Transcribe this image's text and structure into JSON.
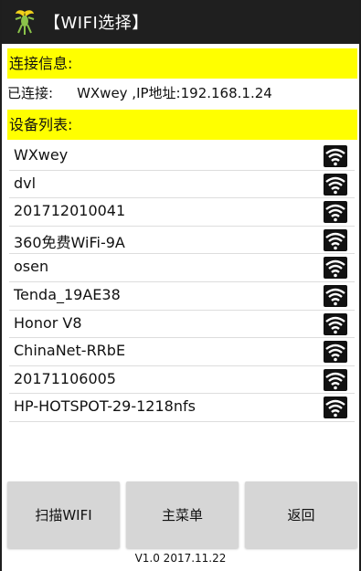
{
  "app": {
    "title": "【WIFI选择】"
  },
  "connection": {
    "section_label": "连接信息:",
    "status_label": "已连接:",
    "status_value": "WXwey ,IP地址:192.168.1.24"
  },
  "devices": {
    "section_label": "设备列表:",
    "items": [
      {
        "name": "WXwey",
        "icon": "wifi-signal-icon"
      },
      {
        "name": "dvl",
        "icon": "wifi-signal-icon"
      },
      {
        "name": "201712010041",
        "icon": "wifi-signal-icon"
      },
      {
        "name": "360免费WiFi-9A",
        "icon": "wifi-signal-icon"
      },
      {
        "name": " osen",
        "icon": "wifi-signal-icon"
      },
      {
        "name": "Tenda_19AE38",
        "icon": "wifi-signal-icon"
      },
      {
        "name": "Honor V8",
        "icon": "wifi-signal-icon"
      },
      {
        "name": "ChinaNet-RRbE",
        "icon": "wifi-signal-icon"
      },
      {
        "name": "20171106005",
        "icon": "wifi-signal-icon"
      },
      {
        "name": "HP-HOTSPOT-29-1218nfs",
        "icon": "wifi-signal-icon"
      }
    ]
  },
  "buttons": {
    "scan": "扫描WIFI",
    "menu": "主菜单",
    "back": "返回"
  },
  "footer": {
    "version": "V1.0 2017.11.22"
  },
  "colors": {
    "title_bar": "#1f1f1f",
    "section_bar": "#ffff00",
    "button": "#d6d6d6"
  }
}
